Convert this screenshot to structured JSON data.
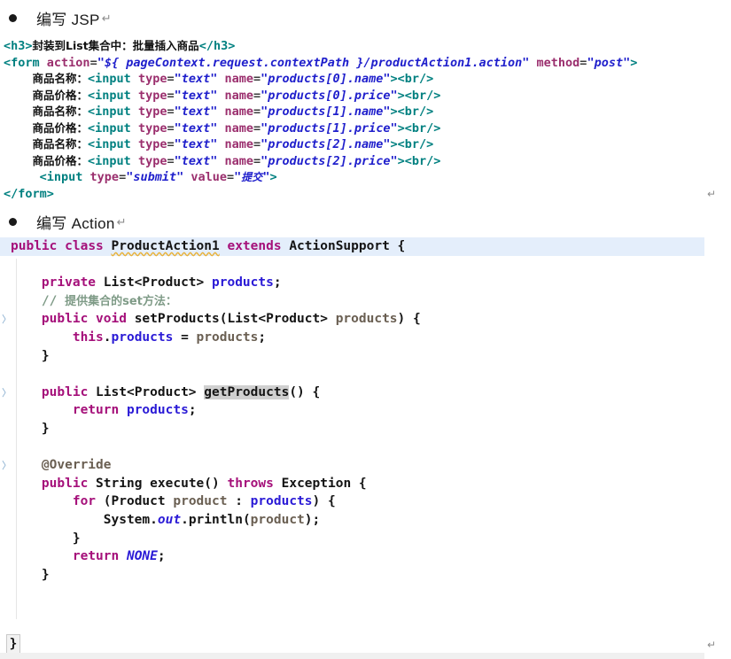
{
  "document": {
    "sections": [
      {
        "bullet": "•",
        "title": "编写 JSP",
        "return_mark": "↵"
      },
      {
        "bullet": "•",
        "title": "编写 Action",
        "return_mark": "↵"
      }
    ],
    "return_marks": {
      "glyph": "↵"
    }
  },
  "jsp_code": {
    "language": "jsp",
    "lines": [
      {
        "id": "jsp-l1",
        "tokens": [
          {
            "t": "<h3>",
            "c": "tag"
          },
          {
            "t": "封装到List集合中：批量插入商品",
            "c": "cn"
          },
          {
            "t": "</h3>",
            "c": "tag"
          }
        ]
      },
      {
        "id": "jsp-l2",
        "tokens": [
          {
            "t": "<form ",
            "c": "tag"
          },
          {
            "t": "action",
            "c": "attr"
          },
          {
            "t": "=",
            "c": "eq"
          },
          {
            "t": "\"${ pageContext.request.contextPath }/productAction1.action\"",
            "c": "val"
          },
          {
            "t": " ",
            "c": "plain"
          },
          {
            "t": "method",
            "c": "attr"
          },
          {
            "t": "=",
            "c": "eq"
          },
          {
            "t": "\"post\"",
            "c": "val"
          },
          {
            "t": ">",
            "c": "tag"
          }
        ]
      },
      {
        "id": "jsp-l3",
        "indent": 4,
        "tokens": [
          {
            "t": "商品名称：",
            "c": "cn"
          },
          {
            "t": "<input ",
            "c": "tag"
          },
          {
            "t": "type",
            "c": "attr"
          },
          {
            "t": "=",
            "c": "eq"
          },
          {
            "t": "\"text\"",
            "c": "val"
          },
          {
            "t": " ",
            "c": "plain"
          },
          {
            "t": "name",
            "c": "attr"
          },
          {
            "t": "=",
            "c": "eq"
          },
          {
            "t": "\"products[0].name\"",
            "c": "val"
          },
          {
            "t": ">",
            "c": "tag"
          },
          {
            "t": "<br/>",
            "c": "tag"
          }
        ]
      },
      {
        "id": "jsp-l4",
        "indent": 4,
        "tokens": [
          {
            "t": "商品价格：",
            "c": "cn"
          },
          {
            "t": "<input ",
            "c": "tag"
          },
          {
            "t": "type",
            "c": "attr"
          },
          {
            "t": "=",
            "c": "eq"
          },
          {
            "t": "\"text\"",
            "c": "val"
          },
          {
            "t": " ",
            "c": "plain"
          },
          {
            "t": "name",
            "c": "attr"
          },
          {
            "t": "=",
            "c": "eq"
          },
          {
            "t": "\"products[0].price\"",
            "c": "val"
          },
          {
            "t": ">",
            "c": "tag"
          },
          {
            "t": "<br/>",
            "c": "tag"
          }
        ]
      },
      {
        "id": "jsp-l5",
        "indent": 4,
        "tokens": [
          {
            "t": "商品名称：",
            "c": "cn"
          },
          {
            "t": "<input ",
            "c": "tag"
          },
          {
            "t": "type",
            "c": "attr"
          },
          {
            "t": "=",
            "c": "eq"
          },
          {
            "t": "\"text\"",
            "c": "val"
          },
          {
            "t": " ",
            "c": "plain"
          },
          {
            "t": "name",
            "c": "attr"
          },
          {
            "t": "=",
            "c": "eq"
          },
          {
            "t": "\"products[1].name\"",
            "c": "val"
          },
          {
            "t": ">",
            "c": "tag"
          },
          {
            "t": "<br/>",
            "c": "tag"
          }
        ]
      },
      {
        "id": "jsp-l6",
        "indent": 4,
        "tokens": [
          {
            "t": "商品价格：",
            "c": "cn"
          },
          {
            "t": "<input ",
            "c": "tag"
          },
          {
            "t": "type",
            "c": "attr"
          },
          {
            "t": "=",
            "c": "eq"
          },
          {
            "t": "\"text\"",
            "c": "val"
          },
          {
            "t": " ",
            "c": "plain"
          },
          {
            "t": "name",
            "c": "attr"
          },
          {
            "t": "=",
            "c": "eq"
          },
          {
            "t": "\"products[1].price\"",
            "c": "val"
          },
          {
            "t": ">",
            "c": "tag"
          },
          {
            "t": "<br/>",
            "c": "tag"
          }
        ]
      },
      {
        "id": "jsp-l7",
        "indent": 4,
        "tokens": [
          {
            "t": "商品名称：",
            "c": "cn"
          },
          {
            "t": "<input ",
            "c": "tag"
          },
          {
            "t": "type",
            "c": "attr"
          },
          {
            "t": "=",
            "c": "eq"
          },
          {
            "t": "\"text\"",
            "c": "val"
          },
          {
            "t": " ",
            "c": "plain"
          },
          {
            "t": "name",
            "c": "attr"
          },
          {
            "t": "=",
            "c": "eq"
          },
          {
            "t": "\"products[2].name\"",
            "c": "val"
          },
          {
            "t": ">",
            "c": "tag"
          },
          {
            "t": "<br/>",
            "c": "tag"
          }
        ]
      },
      {
        "id": "jsp-l8",
        "indent": 4,
        "tokens": [
          {
            "t": "商品价格：",
            "c": "cn"
          },
          {
            "t": "<input ",
            "c": "tag"
          },
          {
            "t": "type",
            "c": "attr"
          },
          {
            "t": "=",
            "c": "eq"
          },
          {
            "t": "\"text\"",
            "c": "val"
          },
          {
            "t": " ",
            "c": "plain"
          },
          {
            "t": "name",
            "c": "attr"
          },
          {
            "t": "=",
            "c": "eq"
          },
          {
            "t": "\"products[2].price\"",
            "c": "val"
          },
          {
            "t": ">",
            "c": "tag"
          },
          {
            "t": "<br/>",
            "c": "tag"
          }
        ]
      },
      {
        "id": "jsp-l9",
        "indent": 5,
        "tokens": [
          {
            "t": "<input ",
            "c": "tag"
          },
          {
            "t": "type",
            "c": "attr"
          },
          {
            "t": "=",
            "c": "eq"
          },
          {
            "t": "\"submit\"",
            "c": "val"
          },
          {
            "t": " ",
            "c": "plain"
          },
          {
            "t": "value",
            "c": "attr"
          },
          {
            "t": "=",
            "c": "eq"
          },
          {
            "t": "\"",
            "c": "val"
          },
          {
            "t": "提交",
            "c": "val-cn"
          },
          {
            "t": "\"",
            "c": "val"
          },
          {
            "t": ">",
            "c": "tag"
          }
        ]
      },
      {
        "id": "jsp-l10",
        "tokens": [
          {
            "t": "</form>",
            "c": "tag"
          }
        ]
      }
    ]
  },
  "java_code": {
    "language": "java",
    "class_name": "ProductAction1",
    "lines": [
      {
        "id": "java-l1",
        "highlight": true,
        "tokens": [
          {
            "t": "public",
            "c": "kw"
          },
          {
            "t": " ",
            "c": "punct"
          },
          {
            "t": "class",
            "c": "kw"
          },
          {
            "t": " ",
            "c": "punct"
          },
          {
            "t": "ProductAction1",
            "c": "type",
            "squiggle": true
          },
          {
            "t": " ",
            "c": "punct"
          },
          {
            "t": "extends",
            "c": "kw"
          },
          {
            "t": " ",
            "c": "punct"
          },
          {
            "t": "ActionSupport",
            "c": "type"
          },
          {
            "t": " ",
            "c": "punct"
          },
          {
            "t": "{",
            "c": "punct"
          }
        ]
      },
      {
        "id": "java-l2",
        "tokens": []
      },
      {
        "id": "java-l3",
        "indent": 4,
        "tokens": [
          {
            "t": "private",
            "c": "kw"
          },
          {
            "t": " ",
            "c": "punct"
          },
          {
            "t": "List<Product>",
            "c": "type"
          },
          {
            "t": " ",
            "c": "punct"
          },
          {
            "t": "products",
            "c": "field"
          },
          {
            "t": ";",
            "c": "punct"
          }
        ]
      },
      {
        "id": "java-l4",
        "indent": 4,
        "tokens": [
          {
            "t": "// ",
            "c": "comment"
          },
          {
            "t": "提供集合的set方法：",
            "c": "comment-cn"
          }
        ]
      },
      {
        "id": "java-l5",
        "indent": 4,
        "marker": true,
        "tokens": [
          {
            "t": "public",
            "c": "kw"
          },
          {
            "t": " ",
            "c": "punct"
          },
          {
            "t": "void",
            "c": "kw"
          },
          {
            "t": " ",
            "c": "punct"
          },
          {
            "t": "setProducts",
            "c": "method"
          },
          {
            "t": "(",
            "c": "punct"
          },
          {
            "t": "List<Product>",
            "c": "type"
          },
          {
            "t": " ",
            "c": "punct"
          },
          {
            "t": "products",
            "c": "ident"
          },
          {
            "t": ") ",
            "c": "punct"
          },
          {
            "t": "{",
            "c": "punct"
          }
        ]
      },
      {
        "id": "java-l6",
        "indent": 8,
        "tokens": [
          {
            "t": "this",
            "c": "kw"
          },
          {
            "t": ".",
            "c": "punct"
          },
          {
            "t": "products",
            "c": "field"
          },
          {
            "t": " = ",
            "c": "punct"
          },
          {
            "t": "products",
            "c": "ident"
          },
          {
            "t": ";",
            "c": "punct"
          }
        ]
      },
      {
        "id": "java-l7",
        "indent": 4,
        "tokens": [
          {
            "t": "}",
            "c": "punct"
          }
        ]
      },
      {
        "id": "java-l8",
        "tokens": []
      },
      {
        "id": "java-l9",
        "indent": 4,
        "marker": true,
        "tokens": [
          {
            "t": "public",
            "c": "kw"
          },
          {
            "t": " ",
            "c": "punct"
          },
          {
            "t": "List<Product>",
            "c": "type"
          },
          {
            "t": " ",
            "c": "punct"
          },
          {
            "t": "getProducts",
            "c": "method",
            "selected": true
          },
          {
            "t": "() ",
            "c": "punct"
          },
          {
            "t": "{",
            "c": "punct"
          }
        ]
      },
      {
        "id": "java-l10",
        "indent": 8,
        "tokens": [
          {
            "t": "return",
            "c": "kw"
          },
          {
            "t": " ",
            "c": "punct"
          },
          {
            "t": "products",
            "c": "field"
          },
          {
            "t": ";",
            "c": "punct"
          }
        ]
      },
      {
        "id": "java-l11",
        "indent": 4,
        "tokens": [
          {
            "t": "}",
            "c": "punct"
          }
        ]
      },
      {
        "id": "java-l12",
        "tokens": []
      },
      {
        "id": "java-l13",
        "indent": 4,
        "marker": true,
        "tokens": [
          {
            "t": "@Override",
            "c": "anno"
          }
        ]
      },
      {
        "id": "java-l14",
        "indent": 4,
        "tokens": [
          {
            "t": "public",
            "c": "kw"
          },
          {
            "t": " ",
            "c": "punct"
          },
          {
            "t": "String",
            "c": "type"
          },
          {
            "t": " ",
            "c": "punct"
          },
          {
            "t": "execute",
            "c": "method"
          },
          {
            "t": "() ",
            "c": "punct"
          },
          {
            "t": "throws",
            "c": "kw"
          },
          {
            "t": " ",
            "c": "punct"
          },
          {
            "t": "Exception",
            "c": "type"
          },
          {
            "t": " ",
            "c": "punct"
          },
          {
            "t": "{",
            "c": "punct"
          }
        ]
      },
      {
        "id": "java-l15",
        "indent": 8,
        "tokens": [
          {
            "t": "for",
            "c": "kw"
          },
          {
            "t": " ",
            "c": "punct"
          },
          {
            "t": "(",
            "c": "punct"
          },
          {
            "t": "Product",
            "c": "type"
          },
          {
            "t": " ",
            "c": "punct"
          },
          {
            "t": "product",
            "c": "ident"
          },
          {
            "t": " : ",
            "c": "punct"
          },
          {
            "t": "products",
            "c": "field"
          },
          {
            "t": ") ",
            "c": "punct"
          },
          {
            "t": "{",
            "c": "punct"
          }
        ]
      },
      {
        "id": "java-l16",
        "indent": 12,
        "tokens": [
          {
            "t": "System",
            "c": "type"
          },
          {
            "t": ".",
            "c": "punct"
          },
          {
            "t": "out",
            "c": "static"
          },
          {
            "t": ".",
            "c": "punct"
          },
          {
            "t": "println",
            "c": "method"
          },
          {
            "t": "(",
            "c": "punct"
          },
          {
            "t": "product",
            "c": "ident"
          },
          {
            "t": ");",
            "c": "punct"
          }
        ]
      },
      {
        "id": "java-l17",
        "indent": 8,
        "tokens": [
          {
            "t": "}",
            "c": "punct"
          }
        ]
      },
      {
        "id": "java-l18",
        "indent": 8,
        "tokens": [
          {
            "t": "return",
            "c": "kw"
          },
          {
            "t": " ",
            "c": "punct"
          },
          {
            "t": "NONE",
            "c": "static"
          },
          {
            "t": ";",
            "c": "punct"
          }
        ]
      },
      {
        "id": "java-l19",
        "indent": 4,
        "tokens": [
          {
            "t": "}",
            "c": "punct"
          }
        ]
      },
      {
        "id": "java-l20",
        "tokens": []
      },
      {
        "id": "java-l21",
        "tokens": []
      }
    ],
    "final_brace": "}"
  },
  "colors": {
    "page_background": "#ffffff",
    "code_highlight": "#e4eefb",
    "selection_highlight": "#d0d0d0",
    "tag": "#008080",
    "attribute": "#9b2f6e",
    "string_value": "#2020cc",
    "java_keyword": "#a5107a",
    "java_field": "#2a1ad6",
    "java_identifier": "#6a5f52",
    "java_comment": "#7f9b87",
    "squiggle_underline": "#e8b23a",
    "gutter_marker": "#7fa8cc",
    "return_mark": "#8c8c8c"
  }
}
